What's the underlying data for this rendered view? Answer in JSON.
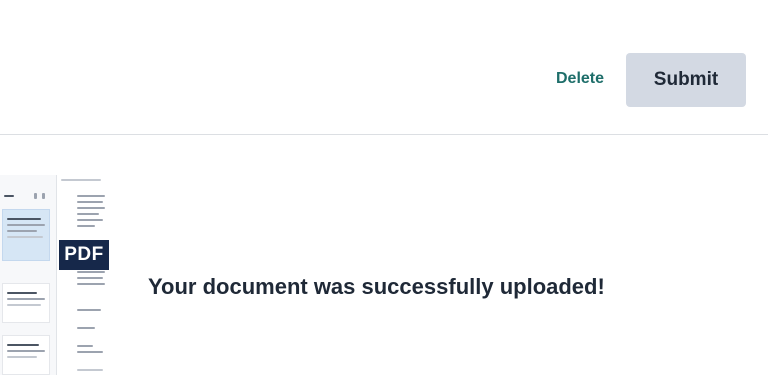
{
  "actions": {
    "delete_label": "Delete",
    "submit_label": "Submit"
  },
  "upload": {
    "file_type_badge": "PDF",
    "success_message": "Your document was successfully uploaded!"
  },
  "colors": {
    "delete_link": "#1e6e6a",
    "submit_background": "#d3d9e3",
    "pdf_badge_background": "#16284a",
    "divider": "#dcdfe3"
  },
  "icons": [
    "pdf-icon"
  ]
}
